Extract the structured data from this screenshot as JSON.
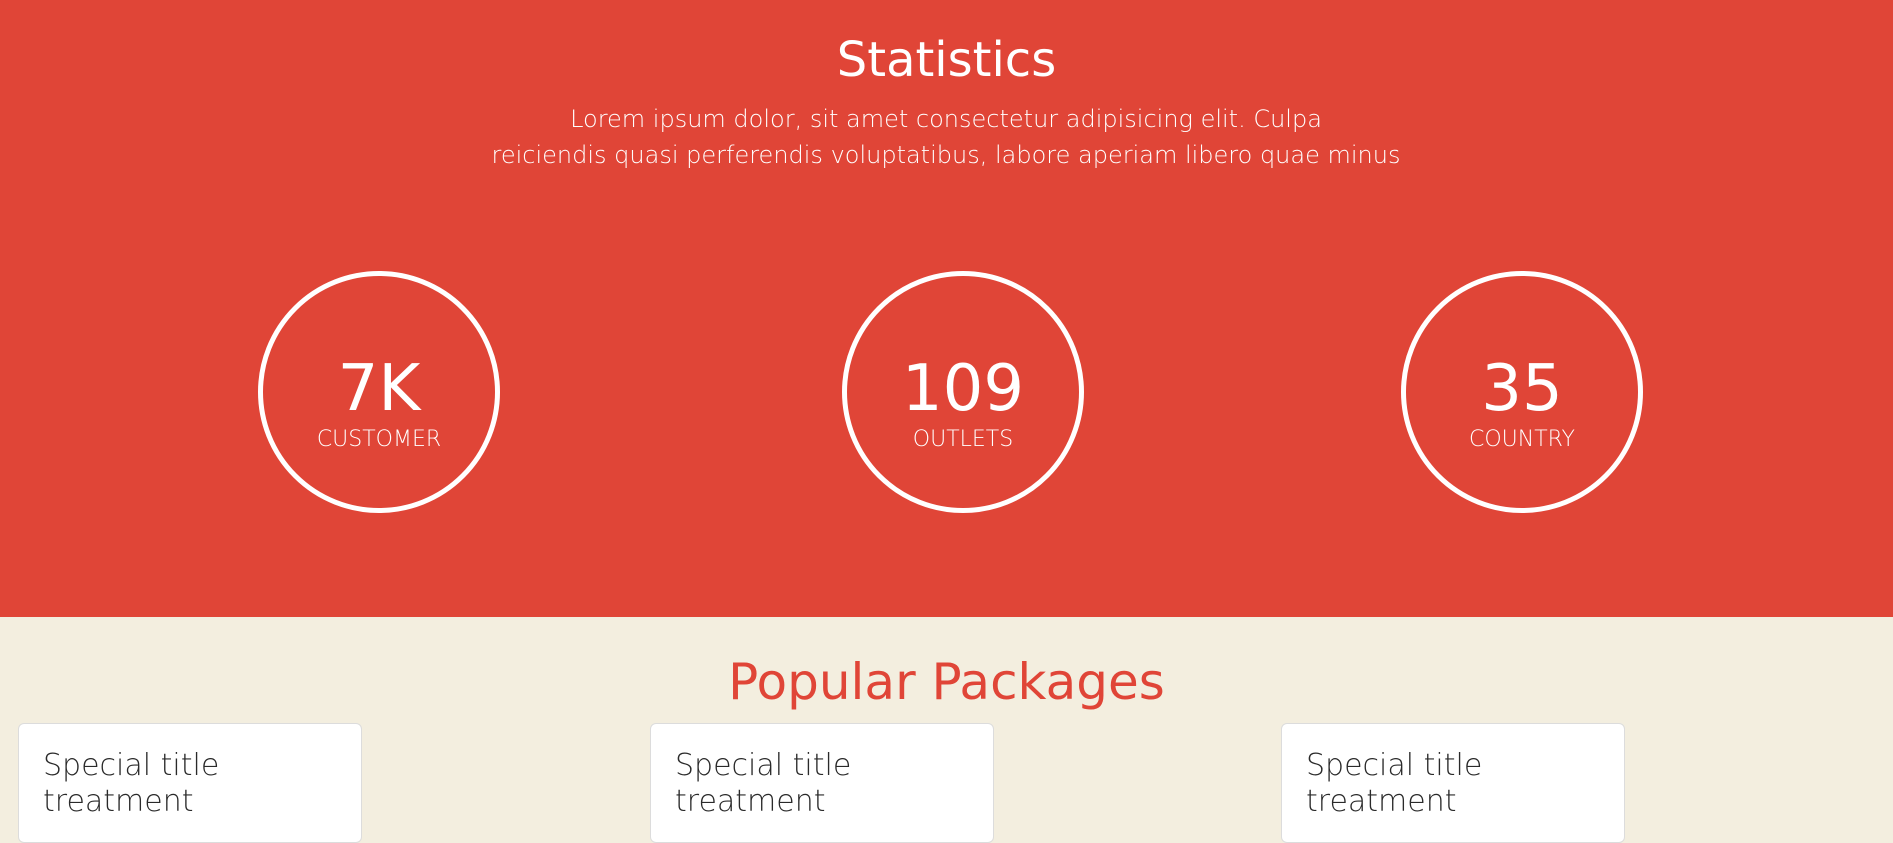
{
  "statistics": {
    "title": "Statistics",
    "description_line1": "Lorem ipsum dolor, sit amet consectetur adipisicing elit. Culpa",
    "description_line2": "reiciendis quasi perferendis voluptatibus, labore aperiam libero quae minus",
    "items": [
      {
        "value": "7K",
        "label": "CUSTOMER"
      },
      {
        "value": "109",
        "label": "OUTLETS"
      },
      {
        "value": "35",
        "label": "COUNTRY"
      }
    ]
  },
  "packages": {
    "title": "Popular Packages",
    "cards": [
      {
        "title": "Special title treatment"
      },
      {
        "title": "Special title treatment"
      },
      {
        "title": "Special title treatment"
      }
    ]
  },
  "colors": {
    "accent": "#E04537",
    "background": "#F3EEDF",
    "card": "#FFFFFF"
  }
}
